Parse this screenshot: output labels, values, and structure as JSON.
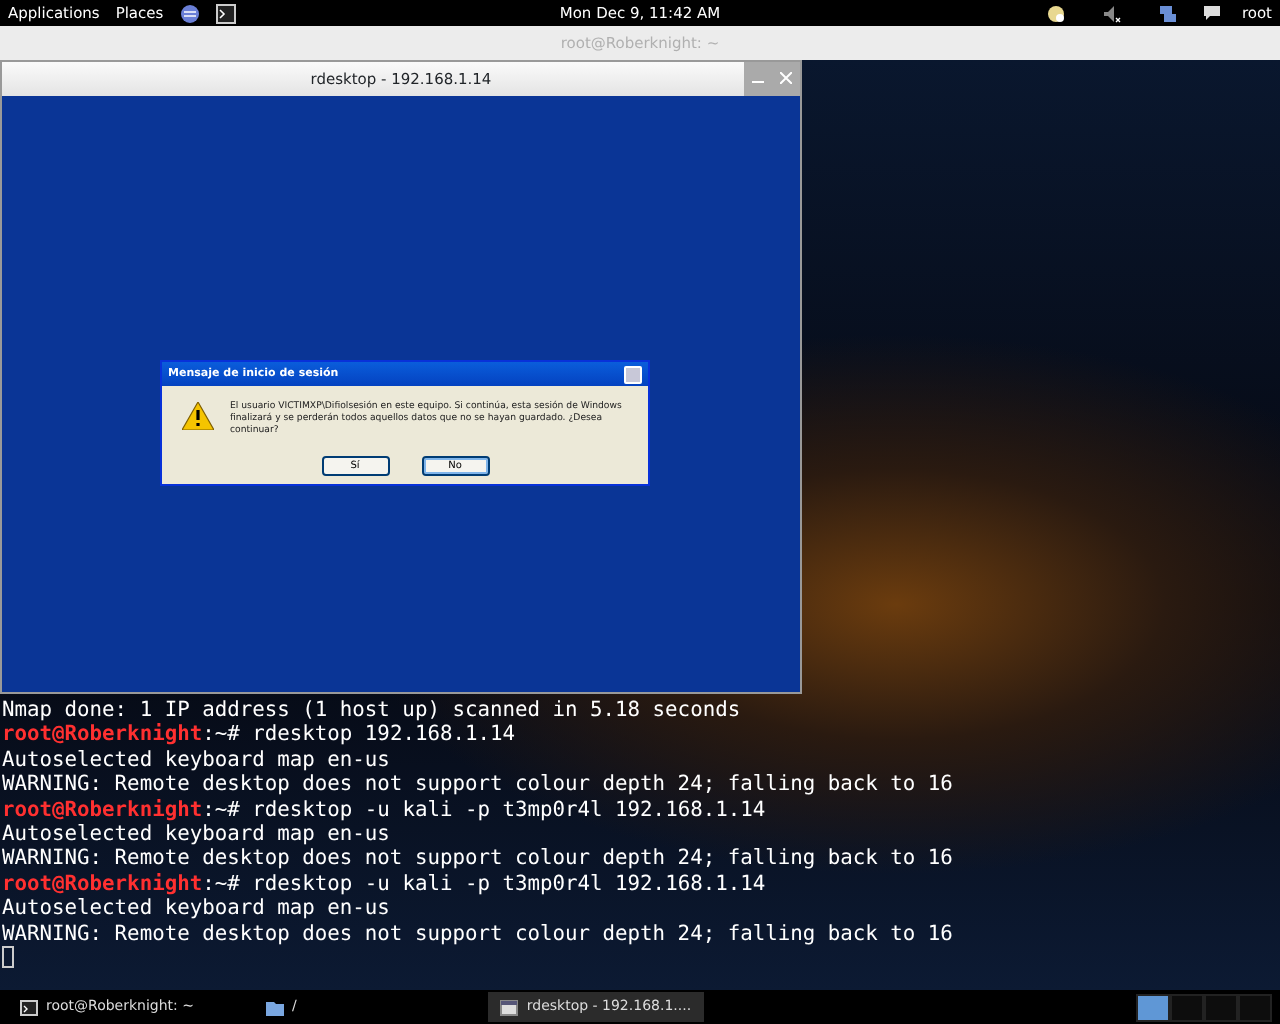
{
  "top_panel": {
    "menus": [
      "Applications",
      "Places"
    ],
    "clock": "Mon Dec  9, 11:42 AM",
    "user": "root"
  },
  "terminal": {
    "title": "root@Roberknight: ~",
    "lines": [
      {
        "kind": "output",
        "text": "Nmap done: 1 IP address (1 host up) scanned in 5.18 seconds"
      },
      {
        "kind": "prompt",
        "user": "root@Roberknight",
        "path": ":~# ",
        "command": "rdesktop 192.168.1.14"
      },
      {
        "kind": "output",
        "text": "Autoselected keyboard map en-us"
      },
      {
        "kind": "output",
        "text": "WARNING: Remote desktop does not support colour depth 24; falling back to 16"
      },
      {
        "kind": "prompt",
        "user": "root@Roberknight",
        "path": ":~# ",
        "command": "rdesktop -u kali -p t3mp0r4l 192.168.1.14"
      },
      {
        "kind": "output",
        "text": "Autoselected keyboard map en-us"
      },
      {
        "kind": "output",
        "text": "WARNING: Remote desktop does not support colour depth 24; falling back to 16"
      },
      {
        "kind": "prompt",
        "user": "root@Roberknight",
        "path": ":~# ",
        "command": "rdesktop -u kali -p t3mp0r4l 192.168.1.14"
      },
      {
        "kind": "output",
        "text": "Autoselected keyboard map en-us"
      },
      {
        "kind": "output",
        "text": "WARNING: Remote desktop does not support colour depth 24; falling back to 16"
      }
    ]
  },
  "rdesktop": {
    "title": "rdesktop - 192.168.1.14",
    "dialog": {
      "title": "Mensaje de inicio de sesión",
      "message": "El usuario VICTIMXP\\Difiolsesión en este equipo. Si continúa, esta sesión de Windows finalizará y se perderán todos aquellos datos que no se hayan guardado. ¿Desea continuar?",
      "buttons": [
        {
          "label": "Sí",
          "selected": false
        },
        {
          "label": "No",
          "selected": true
        }
      ]
    }
  },
  "taskbar": {
    "items": [
      {
        "label": "root@Roberknight: ~",
        "selected": false
      },
      {
        "label": "/",
        "selected": false
      },
      {
        "label": "rdesktop - 192.168.1....",
        "selected": true
      }
    ],
    "workspaces": [
      {
        "selected": true
      },
      {
        "selected": false
      },
      {
        "selected": false
      },
      {
        "selected": false
      }
    ]
  }
}
